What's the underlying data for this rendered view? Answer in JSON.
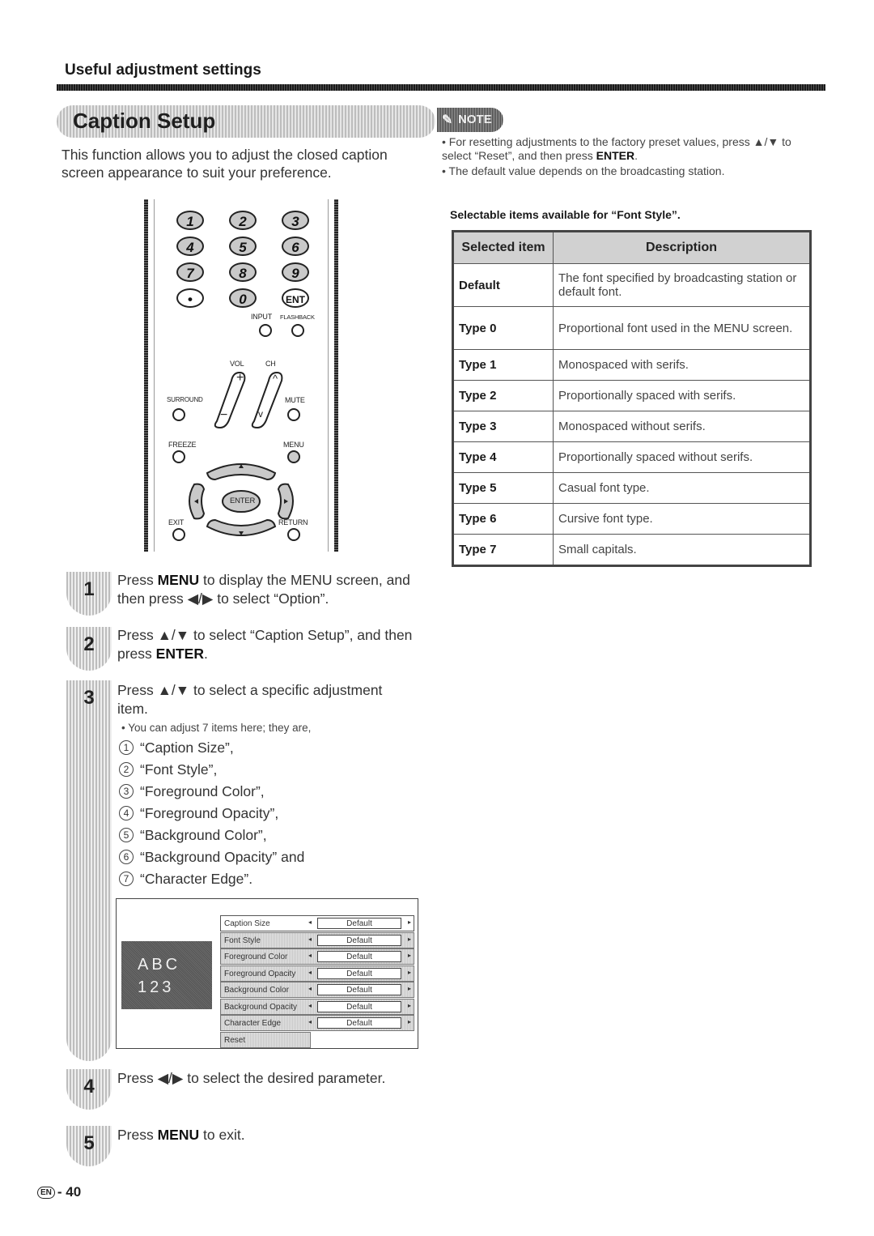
{
  "header": {
    "section_title": "Useful adjustment settings",
    "page_title": "Caption Setup",
    "intro": "This function allows you to adjust the closed caption screen appearance to suit your preference."
  },
  "remote": {
    "number_buttons": [
      "1",
      "2",
      "3",
      "4",
      "5",
      "6",
      "7",
      "8",
      "9",
      "•",
      "0",
      "ENT"
    ],
    "labels": {
      "input": "INPUT",
      "flashback": "FLASHBACK",
      "vol": "VOL",
      "ch": "CH",
      "surround": "SURROUND",
      "mute": "MUTE",
      "freeze": "FREEZE",
      "menu": "MENU",
      "enter": "ENTER",
      "exit": "EXIT",
      "return": "RETURN",
      "vol_plus": "+",
      "vol_minus": "−",
      "ch_up": "^",
      "ch_down": "v"
    }
  },
  "steps": [
    {
      "number": "1",
      "parts": [
        "Press ",
        "MENU",
        " to display the MENU screen, and then press ◀/▶ to select “Option”."
      ]
    },
    {
      "number": "2",
      "parts": [
        "Press ▲/▼ to select “Caption Setup”, and then press ",
        "ENTER",
        "."
      ]
    },
    {
      "number": "3",
      "text": "Press ▲/▼ to select a specific adjustment item.",
      "bullet": "You can adjust 7 items here; they are,",
      "items": [
        {
          "n": "1",
          "label": "“Caption Size”,"
        },
        {
          "n": "2",
          "label": "“Font Style”,"
        },
        {
          "n": "3",
          "label": "“Foreground Color”,"
        },
        {
          "n": "4",
          "label": "“Foreground Opacity”,"
        },
        {
          "n": "5",
          "label": "“Background Color”,"
        },
        {
          "n": "6",
          "label": "“Background Opacity” and"
        },
        {
          "n": "7",
          "label": "“Character Edge”."
        }
      ]
    },
    {
      "number": "4",
      "text": "Press ◀/▶ to select the desired parameter."
    },
    {
      "number": "5",
      "parts": [
        "Press ",
        "MENU",
        " to exit."
      ]
    }
  ],
  "menu_screen": {
    "preview_line1": "ABC",
    "preview_line2": "123",
    "rows": [
      {
        "label": "Caption Size",
        "value": "Default",
        "selected": true
      },
      {
        "label": "Font Style",
        "value": "Default"
      },
      {
        "label": "Foreground Color",
        "value": "Default"
      },
      {
        "label": "Foreground Opacity",
        "value": "Default"
      },
      {
        "label": "Background Color",
        "value": "Default"
      },
      {
        "label": "Background Opacity",
        "value": "Default"
      },
      {
        "label": "Character Edge",
        "value": "Default"
      }
    ],
    "reset_label": "Reset",
    "left_arrow": "◂",
    "right_arrow": "▸"
  },
  "note": {
    "badge": "NOTE",
    "bullets": [
      {
        "parts": [
          "For resetting adjustments to the factory preset values, press ▲/▼ to select “Reset”, and then press ",
          "ENTER",
          "."
        ]
      },
      {
        "parts": [
          "The default value depends on the broadcasting station.",
          "",
          ""
        ]
      }
    ]
  },
  "font_table": {
    "title": "Selectable items available for “Font Style”.",
    "headers": [
      "Selected item",
      "Description"
    ],
    "rows": [
      {
        "item": "Default",
        "description": "The font specified by broadcasting station or default font."
      },
      {
        "item": "Type 0",
        "description": "Proportional font used in the MENU screen."
      },
      {
        "item": "Type 1",
        "description": "Monospaced with serifs."
      },
      {
        "item": "Type 2",
        "description": "Proportionally spaced with serifs."
      },
      {
        "item": "Type 3",
        "description": "Monospaced without serifs."
      },
      {
        "item": "Type 4",
        "description": "Proportionally spaced without serifs."
      },
      {
        "item": "Type 5",
        "description": "Casual font type."
      },
      {
        "item": "Type 6",
        "description": "Cursive font type."
      },
      {
        "item": "Type 7",
        "description": "Small capitals."
      }
    ]
  },
  "footer": {
    "lang_badge": "EN",
    "page_number": "- 40"
  }
}
